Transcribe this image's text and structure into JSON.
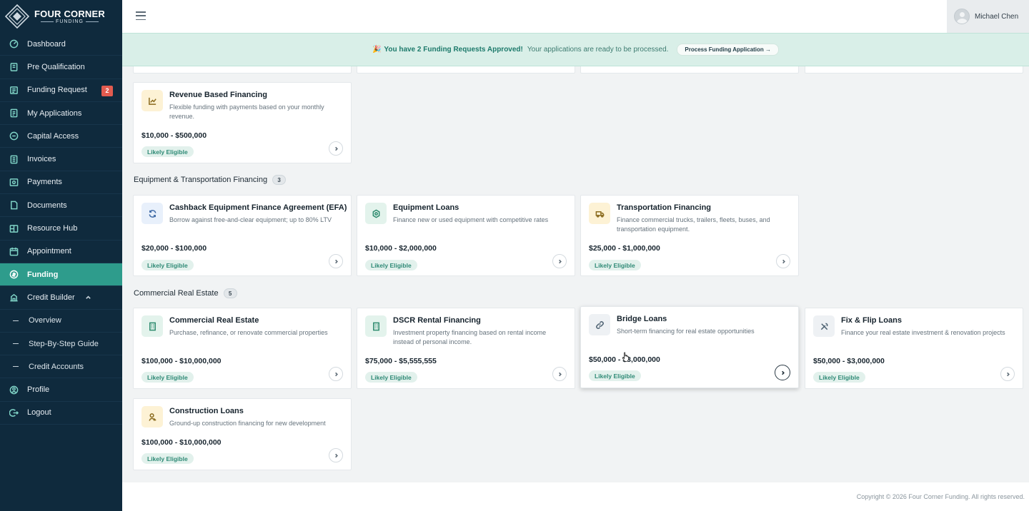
{
  "brand": {
    "title": "FOUR CORNER",
    "subtitle": "FUNDING"
  },
  "sidebar": {
    "items": [
      {
        "label": "Dashboard",
        "icon": "dashboard-icon"
      },
      {
        "label": "Pre Qualification",
        "icon": "clipboard-icon"
      },
      {
        "label": "Funding Request",
        "icon": "request-icon",
        "badge": "2"
      },
      {
        "label": "My Applications",
        "icon": "applications-icon"
      },
      {
        "label": "Capital Access",
        "icon": "capital-icon"
      },
      {
        "label": "Invoices",
        "icon": "invoice-icon"
      },
      {
        "label": "Payments",
        "icon": "payments-icon"
      },
      {
        "label": "Documents",
        "icon": "documents-icon"
      },
      {
        "label": "Resource Hub",
        "icon": "resource-icon"
      },
      {
        "label": "Appointment",
        "icon": "calendar-icon"
      },
      {
        "label": "Funding",
        "icon": "funding-icon",
        "active": true
      },
      {
        "label": "Credit Builder",
        "icon": "credit-builder-icon",
        "expanded": true
      },
      {
        "label": "Overview",
        "sub": true
      },
      {
        "label": "Step-By-Step Guide",
        "sub": true
      },
      {
        "label": "Credit Accounts",
        "sub": true
      },
      {
        "label": "Profile",
        "icon": "profile-icon"
      },
      {
        "label": "Logout",
        "icon": "logout-icon"
      }
    ]
  },
  "topbar": {
    "user_name": "Michael Chen"
  },
  "banner": {
    "bold": "You have 2 Funding Requests Approved!",
    "message": "Your applications are ready to be processed.",
    "button": "Process Funding Application →"
  },
  "sections": {
    "equipment": {
      "title": "Equipment & Transportation Financing",
      "count": "3"
    },
    "real_estate": {
      "title": "Commercial Real Estate",
      "count": "5"
    }
  },
  "cards": {
    "revenue": {
      "title": "Revenue Based Financing",
      "desc": "Flexible funding with payments based on your monthly revenue.",
      "amount": "$10,000 - $500,000",
      "status": "Likely Eligible"
    },
    "efa": {
      "title": "Cashback Equipment Finance Agreement (EFA)",
      "desc": "Borrow against free-and-clear equipment; up to 80% LTV",
      "amount": "$20,000 - $100,000",
      "status": "Likely Eligible"
    },
    "equipment_loans": {
      "title": "Equipment Loans",
      "desc": "Finance new or used equipment with competitive rates",
      "amount": "$10,000 - $2,000,000",
      "status": "Likely Eligible"
    },
    "transportation": {
      "title": "Transportation Financing",
      "desc": "Finance commercial trucks, trailers, fleets, buses, and transportation equipment.",
      "amount": "$25,000 - $1,000,000",
      "status": "Likely Eligible"
    },
    "commercial_re": {
      "title": "Commercial Real Estate",
      "desc": "Purchase, refinance, or renovate commercial properties",
      "amount": "$100,000 - $10,000,000",
      "status": "Likely Eligible"
    },
    "dscr": {
      "title": "DSCR Rental Financing",
      "desc": "Investment property financing based on rental income instead of personal income.",
      "amount": "$75,000 - $5,555,555",
      "status": "Likely Eligible"
    },
    "bridge": {
      "title": "Bridge Loans",
      "desc": "Short-term financing for real estate opportunities",
      "amount": "$50,000 - $3,000,000",
      "status": "Likely Eligible"
    },
    "fix_flip": {
      "title": "Fix & Flip Loans",
      "desc": "Finance your real estate investment & renovation projects",
      "amount": "$50,000 - $3,000,000",
      "status": "Likely Eligible"
    },
    "construction": {
      "title": "Construction Loans",
      "desc": "Ground-up construction financing for new development",
      "amount": "$100,000 - $10,000,000",
      "status": "Likely Eligible"
    }
  },
  "footer": {
    "copyright": "Copyright © 2026 Four Corner Funding. All rights reserved."
  }
}
